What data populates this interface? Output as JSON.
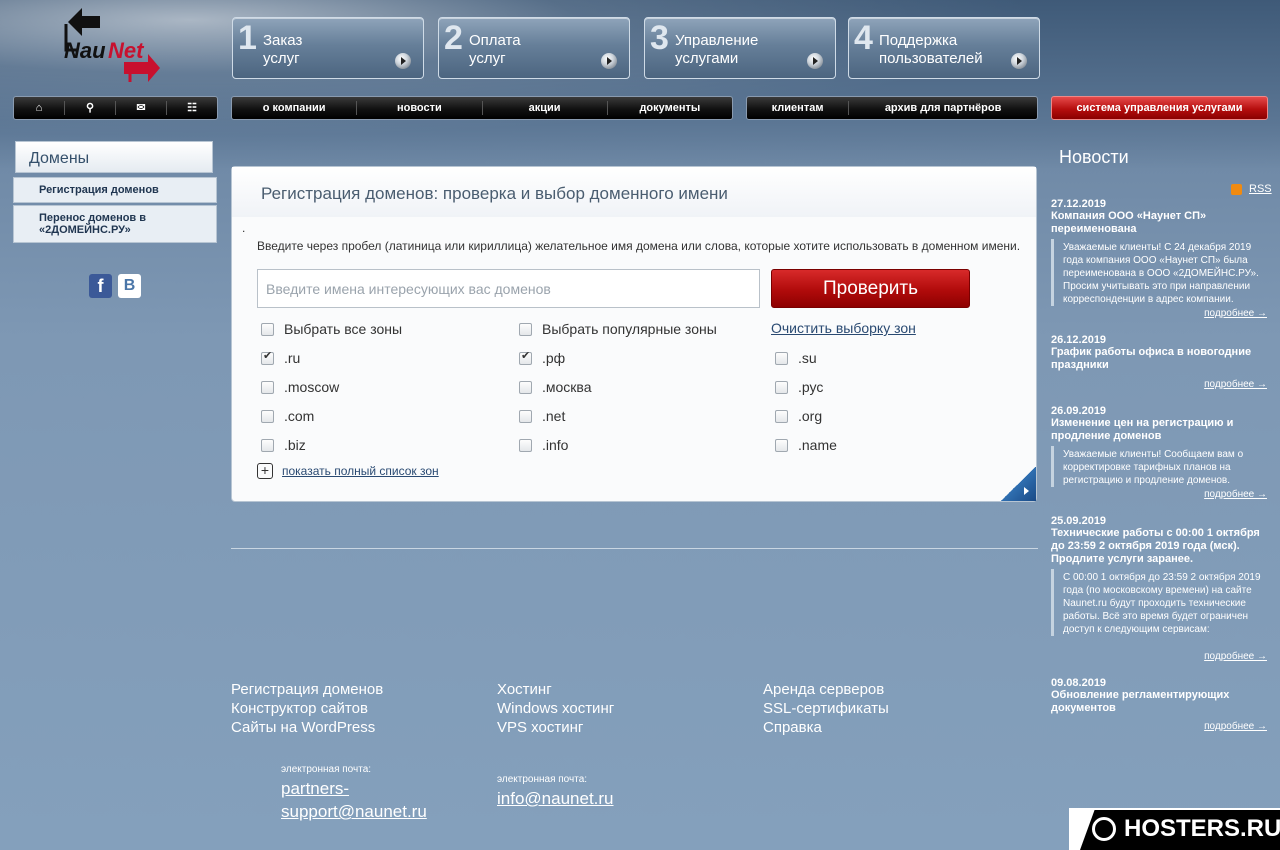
{
  "logo": {
    "text": "NauNet"
  },
  "steps": [
    {
      "num": "1",
      "line1": "Заказ",
      "line2": "услуг"
    },
    {
      "num": "2",
      "line1": "Оплата",
      "line2": "услуг"
    },
    {
      "num": "3",
      "line1": "Управление",
      "line2": "услугами"
    },
    {
      "num": "4",
      "line1": "Поддержка",
      "line2": "пользователей"
    }
  ],
  "nav": {
    "icons": [
      "home-icon",
      "search-icon",
      "mail-icon",
      "sitemap-icon"
    ],
    "main": [
      "о компании",
      "новости",
      "акции",
      "документы"
    ],
    "clients": [
      "клиентам",
      "архив для партнёров"
    ],
    "system": "система управления услугами"
  },
  "left": {
    "section": "Домены",
    "menu": [
      "Регистрация доменов",
      "Перенос доменов в «2ДОМЕЙНС.РУ»"
    ]
  },
  "social": {
    "fb": "f",
    "vk": "B"
  },
  "panel": {
    "title": "Регистрация доменов: проверка и выбор доменного имени",
    "dot": ".",
    "desc": "Введите через пробел (латиница или кириллица) желательное имя домена или слова, которые хотите использовать в доменном имени.",
    "placeholder": "Введите имена интересующих вас доменов",
    "check_label": "Проверить",
    "select_all": "Выбрать все зоны",
    "select_popular": "Выбрать популярные зоны",
    "clear": "Очистить выборку зон",
    "zones": [
      {
        "name": ".ru",
        "checked": true
      },
      {
        "name": ".рф",
        "checked": true
      },
      {
        "name": ".su",
        "checked": false
      },
      {
        "name": ".moscow",
        "checked": false
      },
      {
        "name": ".москва",
        "checked": false
      },
      {
        "name": ".рус",
        "checked": false
      },
      {
        "name": ".com",
        "checked": false
      },
      {
        "name": ".net",
        "checked": false
      },
      {
        "name": ".org",
        "checked": false
      },
      {
        "name": ".biz",
        "checked": false
      },
      {
        "name": ".info",
        "checked": false
      },
      {
        "name": ".name",
        "checked": false
      }
    ],
    "show_all": "показать полный список зон"
  },
  "footer": {
    "col1": [
      "Регистрация доменов",
      "Конструктор сайтов",
      "Сайты на WordPress"
    ],
    "col2": [
      "Хостинг",
      "Windows хостинг",
      "VPS хостинг"
    ],
    "col3": [
      "Аренда серверов",
      "SSL-сертификаты",
      "Справка"
    ],
    "mail_label": "электронная почта:",
    "mail1": "partners-support@naunet.ru",
    "mail2": "info@naunet.ru"
  },
  "news": {
    "title": "Новости",
    "rss": "RSS",
    "more": "подробнее →",
    "items": [
      {
        "date": "27.12.2019",
        "head": "Компания ООО «Наунет СП» переименована",
        "text": "Уважаемые клиенты! С 24 декабря 2019 года компания ООО «Наунет СП» была переименована в ООО «2ДОМЕЙНС.РУ». Просим учитывать это при направлении корреспонденции в адрес компании."
      },
      {
        "date": "26.12.2019",
        "head": "График работы офиса в новогодние праздники",
        "text": ""
      },
      {
        "date": "26.09.2019",
        "head": "Изменение цен на регистрацию и продление доменов",
        "text": "Уважаемые клиенты! Сообщаем вам о корректировке тарифных планов на регистрацию и продление доменов."
      },
      {
        "date": "25.09.2019",
        "head": "Технические работы с 00:00 1 октября до 23:59 2 октября 2019 года (мск). Продлите услуги заранее.",
        "text": "С 00:00 1 октября до 23:59 2 октября 2019 года (по московскому времени) на сайте Naunet.ru будут проходить технические работы. Всё это время будет ограничен доступ к следующим сервисам:"
      },
      {
        "date": "09.08.2019",
        "head": "Обновление регламентирующих документов",
        "text": ""
      }
    ]
  },
  "watermark": "HOSTERS.RU"
}
